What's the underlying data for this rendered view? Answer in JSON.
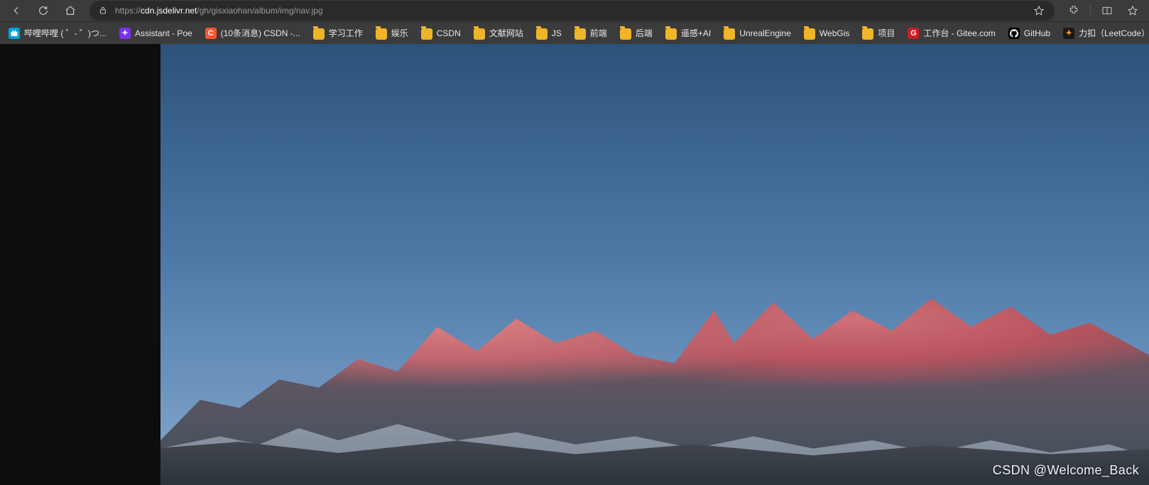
{
  "toolbar": {
    "url": {
      "scheme": "https://",
      "host": "cdn.jsdelivr.net",
      "path": "/gh/gisxiaohan/album/img/nav.jpg"
    }
  },
  "bookmarks": [
    {
      "label": "哔哩哔哩 (  ゜-  ゜)つ...",
      "favicon": "bilibili",
      "glyph": "▶"
    },
    {
      "label": "Assistant - Poe",
      "favicon": "poe",
      "glyph": "✦"
    },
    {
      "label": "(10条消息) CSDN -...",
      "favicon": "csdn",
      "glyph": "C"
    },
    {
      "label": "学习工作",
      "favicon": "folder",
      "glyph": ""
    },
    {
      "label": "娱乐",
      "favicon": "folder",
      "glyph": ""
    },
    {
      "label": "CSDN",
      "favicon": "folder",
      "glyph": ""
    },
    {
      "label": "文献网站",
      "favicon": "folder",
      "glyph": ""
    },
    {
      "label": "JS",
      "favicon": "folder",
      "glyph": ""
    },
    {
      "label": "前端",
      "favicon": "folder",
      "glyph": ""
    },
    {
      "label": "后端",
      "favicon": "folder",
      "glyph": ""
    },
    {
      "label": "遥感+AI",
      "favicon": "folder",
      "glyph": ""
    },
    {
      "label": "UnrealEngine",
      "favicon": "folder",
      "glyph": ""
    },
    {
      "label": "WebGis",
      "favicon": "folder",
      "glyph": ""
    },
    {
      "label": "项目",
      "favicon": "folder",
      "glyph": ""
    },
    {
      "label": "工作台 - Gitee.com",
      "favicon": "gitee",
      "glyph": "G"
    },
    {
      "label": "GitHub",
      "favicon": "github",
      "glyph": ""
    },
    {
      "label": "力扣（LeetCode）...",
      "favicon": "leetcode",
      "glyph": "✦"
    }
  ],
  "watermark": "CSDN @Welcome_Back"
}
